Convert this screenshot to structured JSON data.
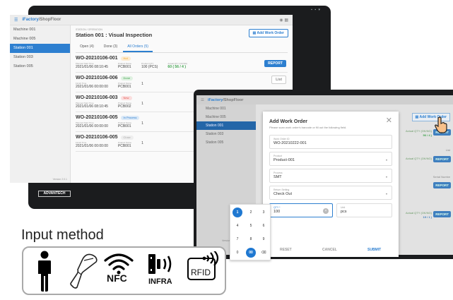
{
  "app": {
    "logo_part1": "iFactory",
    "logo_part2": "/ShopFloor"
  },
  "sidebar": {
    "items": [
      {
        "label": "Machine 001"
      },
      {
        "label": "Machine 005"
      },
      {
        "label": "Station 001"
      },
      {
        "label": "Station 003"
      },
      {
        "label": "Station 005"
      }
    ],
    "version": "Version 2.0.1"
  },
  "station": {
    "breadcrumb": "STATION / OPERATION",
    "title": "Station 001 : Visual Inspection",
    "add_button": "Add Work Order"
  },
  "tabs": [
    {
      "label": "Open (4)"
    },
    {
      "label": "Done (3)"
    },
    {
      "label": "All Orders (5)"
    }
  ],
  "work_orders": [
    {
      "no": "WO-20210106-001",
      "status": "Hot",
      "time_label": "Planned Start Time",
      "time": "2021/01/06 08:10:45",
      "product_label": "Product Name",
      "product": "PCB001",
      "qty_label": "Product QTY",
      "qty": "100 (PCS)",
      "actual_label": "Actual QTY (OK/NG)",
      "actual": "60 ( 56 / 4 )",
      "action": "REPORT"
    },
    {
      "no": "WO-20210106-006",
      "status": "Done",
      "time_label": "Finish Time",
      "time": "2021/01/06 00:00:00",
      "product_label": "Product Name",
      "product": "PCB001",
      "qty": "1",
      "action": "List"
    },
    {
      "no": "WO-20210106-003",
      "status": "New",
      "time_label": "Planned Start Time",
      "time": "2021/01/06 08:10:45",
      "product_label": "Product Name",
      "product": "PCB002",
      "qty": "1"
    },
    {
      "no": "WO-20210106-005",
      "status": "In Process",
      "time_label": "Planned Start Time",
      "time": "2021/01/06 00:00:00",
      "product_label": "Product Name",
      "product": "PCB001",
      "qty": "1"
    },
    {
      "no": "WO-20210106-005",
      "status": "Close",
      "time_label": "Finish Time",
      "time": "2021/01/06 00:00:00",
      "product_label": "Product Name",
      "product": "PCB001",
      "qty": "1"
    }
  ],
  "device_brand": "ADVANTECH",
  "dialog": {
    "title": "Add Work Order",
    "subtitle": "Please scan work order's barcode or fill out the following field.",
    "fields": {
      "work_order": {
        "label": "Work Order ID",
        "value": "WO-20210222-001"
      },
      "product": {
        "label": "Product",
        "value": "Product-001"
      },
      "process": {
        "label": "Process",
        "value": "SMT"
      },
      "routing": {
        "label": "Return Setting",
        "value": "Check Out"
      },
      "qty": {
        "label": "QTY *",
        "value": "100"
      },
      "unit": {
        "label": "Unit",
        "value": "pcs"
      }
    },
    "reset": "RESET",
    "cancel": "CANCEL",
    "submit": "SUBMIT"
  },
  "background_right": {
    "actual_label": "Actual QTY (OK/NG)",
    "row1_value": "56 / 4 )",
    "row2_value": "19 / 1 )",
    "note1": "List",
    "note2": "Serial Numbe",
    "report": "REPORT"
  },
  "keypad": {
    "keys": [
      "1",
      "2",
      "3",
      "4",
      "5",
      "6",
      "7",
      "8",
      "9",
      "0",
      "00",
      "⌫"
    ]
  },
  "input_method": {
    "title": "Input method",
    "icons": [
      {
        "name": "person-icon"
      },
      {
        "name": "barcode-scanner-icon"
      },
      {
        "name": "nfc-icon",
        "label": "NFC"
      },
      {
        "name": "infrared-icon",
        "label": "INFRA"
      },
      {
        "name": "rfid-icon",
        "label": "RFID"
      }
    ]
  },
  "colors": {
    "accent": "#2d7fd0",
    "hot": "#f5a623",
    "done": "#3fa34d",
    "new": "#e0514b",
    "in_process": "#2d7fd0",
    "close": "#aaaaaa"
  }
}
